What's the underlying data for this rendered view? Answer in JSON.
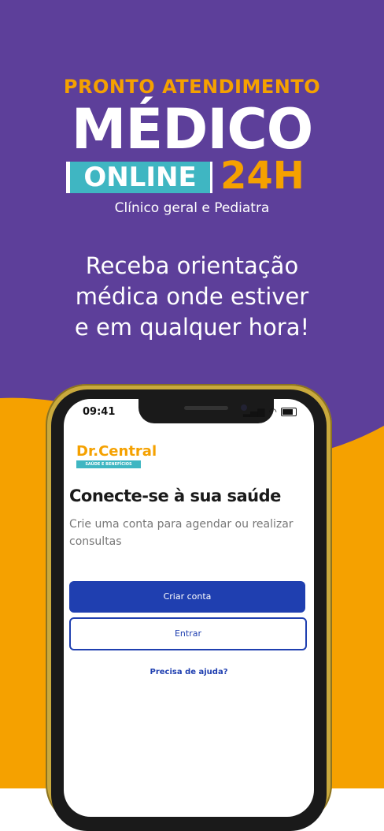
{
  "colors": {
    "purple": "#5d3f9a",
    "orange": "#f5a100",
    "teal": "#3fb6c2",
    "primary_blue": "#1f3fb0"
  },
  "banner": {
    "line1": "PRONTO ATENDIMENTO",
    "line2": "MÉDICO",
    "online": "ONLINE",
    "hours": "24H",
    "specialties": "Clínico geral e Pediatra",
    "tagline_1": "Receba orientação",
    "tagline_2": "médica onde estiver",
    "tagline_3": "e em qualquer hora!"
  },
  "phone": {
    "status_time": "09:41",
    "logo_text": "Dr.Central",
    "logo_sub": "SAÚDE E BENEFÍCIOS",
    "title": "Conecte-se à sua saúde",
    "description": "Crie uma conta para agendar ou realizar consultas",
    "create_account_label": "Criar conta",
    "login_label": "Entrar",
    "help_link": "Precisa de ajuda?"
  }
}
